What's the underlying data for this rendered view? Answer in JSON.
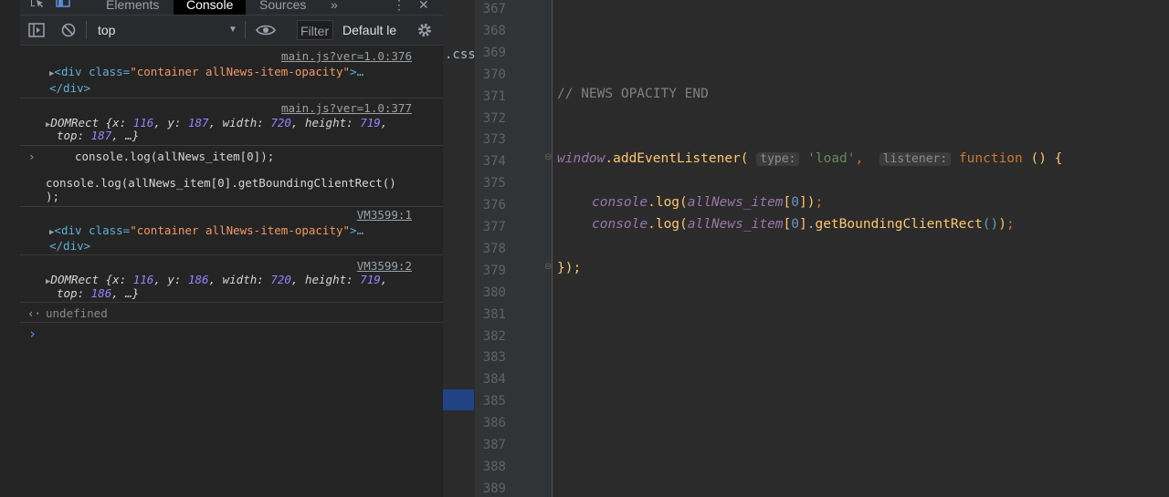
{
  "devtools": {
    "tabs": {
      "elements": "Elements",
      "console": "Console",
      "sources": "Sources",
      "more": "»"
    },
    "toolbar": {
      "context": "top",
      "filter_placeholder": "Filter",
      "levels": "Default le"
    },
    "console": {
      "entries": [
        {
          "source": "main.js?ver=1.0:376",
          "line1_pre": "<div class=",
          "line1_val": "\"container allNews-item-opacity\"",
          "line1_post": ">…",
          "line2": "</div>"
        },
        {
          "source": "main.js?ver=1.0:377",
          "obj": "DOMRect {",
          "k1": "x",
          "v1": "116",
          "k2": "y",
          "v2": "187",
          "k3": "width",
          "v3": "720",
          "k4": "height",
          "v4": "719",
          "k5": "top",
          "v5": "187",
          "tail": ", …}"
        },
        {
          "input1": "console.log(allNews_item[0]);",
          "input2": "console.log(allNews_item[0].getBoundingClientRect()",
          "input3": ");"
        },
        {
          "source": "VM3599:1",
          "line1_pre": "<div class=",
          "line1_val": "\"container allNews-item-opacity\"",
          "line1_post": ">…",
          "line2": "</div>"
        },
        {
          "source": "VM3599:2",
          "obj": "DOMRect {",
          "k1": "x",
          "v1": "116",
          "k2": "y",
          "v2": "186",
          "k3": "width",
          "v3": "720",
          "k4": "height",
          "v4": "719",
          "k5": "top",
          "v5": "186",
          "tail": ", …}"
        },
        {
          "result": "undefined"
        }
      ]
    }
  },
  "editor": {
    "file_fragment": ".css",
    "line_numbers": [
      "367",
      "368",
      "369",
      "370",
      "371",
      "372",
      "373",
      "374",
      "375",
      "376",
      "377",
      "378",
      "379",
      "380",
      "381",
      "382",
      "383",
      "384",
      "385",
      "386",
      "387",
      "388",
      "389"
    ],
    "code": {
      "comment": "// NEWS OPACITY END",
      "l374_window": "window",
      "l374_method": ".addEventListener(",
      "l374_hint_type": "type:",
      "l374_str": "'load'",
      "l374_hint_listener": "listener:",
      "l374_fn": "function",
      "l374_tail": " () {",
      "l376_console": "console",
      "l376_log": ".log(",
      "l376_var": "allNews_item",
      "l376_idx": "0",
      "l377_method": "getBoundingClientRect",
      "l379": "});"
    }
  }
}
